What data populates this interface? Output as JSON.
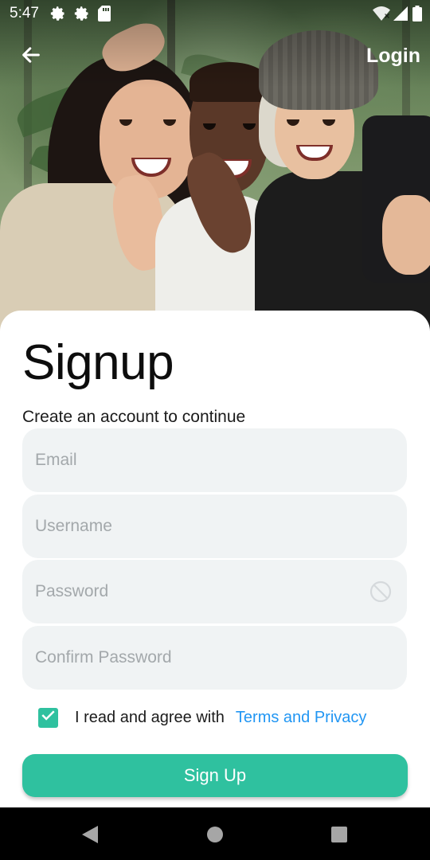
{
  "status_bar": {
    "time": "5:47",
    "icons": [
      "settings-icon",
      "settings-icon",
      "sd-card-icon",
      "wifi-icon",
      "signal-icon",
      "battery-icon"
    ]
  },
  "nav": {
    "back_icon": "arrow-back-icon",
    "login_label": "Login"
  },
  "hero": {
    "image": "three-friends-selfie-photo"
  },
  "form": {
    "title": "Signup",
    "subtitle": "Create an account to continue",
    "email": {
      "placeholder": "Email",
      "value": ""
    },
    "username": {
      "placeholder": "Username",
      "value": ""
    },
    "password": {
      "placeholder": "Password",
      "value": "",
      "toggle_icon": "visibility-off-icon"
    },
    "confirm_password": {
      "placeholder": "Confirm Password",
      "value": ""
    },
    "agree": {
      "checked": true,
      "text": "I read and agree with",
      "link_label": "Terms and Privacy"
    },
    "submit_label": "Sign Up"
  },
  "system_nav": {
    "buttons": [
      "back-triangle-icon",
      "home-circle-icon",
      "recents-square-icon"
    ]
  },
  "colors": {
    "accent": "#2fc19f",
    "link": "#2196f3",
    "field_bg": "#f0f3f4",
    "placeholder": "#a3a8ab"
  }
}
